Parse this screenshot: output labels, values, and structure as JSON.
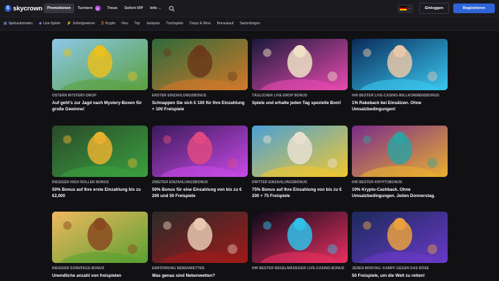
{
  "brand": {
    "name": "skycrown",
    "logo_glyph": "S"
  },
  "nav": [
    {
      "label": "Promotionen",
      "active": true
    },
    {
      "label": "Turniere",
      "badge": "5"
    },
    {
      "label": "Treue"
    },
    {
      "label": "Sofort-VIP"
    },
    {
      "label": "Info",
      "dropdown": true
    }
  ],
  "header": {
    "login_label": "Einloggen",
    "register_label": "Registrieren",
    "language_flag": "de"
  },
  "categories": [
    {
      "icon": "slot-icon",
      "glyph": "▦",
      "label": "Spielautomaten"
    },
    {
      "icon": "live-icon",
      "glyph": "◆",
      "label": "Live-Spiele"
    },
    {
      "icon": "lightning-icon",
      "glyph": "⚡",
      "label": "Sofortgewinne"
    },
    {
      "icon": "crypto-icon",
      "glyph": "₿",
      "label": "Krypto"
    },
    {
      "label": "Neu"
    },
    {
      "label": "Top"
    },
    {
      "label": "Jackpots"
    },
    {
      "label": "Tischspiele"
    },
    {
      "label": "Drops & Wins"
    },
    {
      "label": "Bonuskauf"
    },
    {
      "label": "Sammlungen"
    }
  ],
  "promos": [
    {
      "category": "OSTERN MYSTERY-DROP",
      "title": "Auf geht's zur Jagd nach Mystery-Boxen für große Gewinne!",
      "colors": [
        "#8cc8e8",
        "#5aa040",
        "#e8c020"
      ]
    },
    {
      "category": "ERSTER EINZAHLUNGSBONUS",
      "title": "Schnappen Sie sich € 100 für Ihre Einzahlung + 100 Freispiele",
      "colors": [
        "#2d6a3a",
        "#d2782a",
        "#6a3a1a"
      ]
    },
    {
      "category": "TÄGLICHER LIVE-DROP BONUS",
      "title": "Spiele und erhalte jeden Tag spezielle Boni!",
      "colors": [
        "#1a1a3a",
        "#e84ab0",
        "#f0e0c8"
      ]
    },
    {
      "category": "IHR BESTER LIVE-CASINO-WILLKOMMENSBONUS",
      "title": "1% Rakeback bei Einsätzen. Ohne Umsatzbedingungen!",
      "colors": [
        "#0a2a5a",
        "#3ac8f0",
        "#e8c8a8"
      ]
    },
    {
      "category": "RIESIGER HIGH ROLLER BONUS",
      "title": "50% Bonus auf Ihre erste Einzahlung bis zu €2,000",
      "colors": [
        "#2a4a2a",
        "#3aa040",
        "#e8b030"
      ]
    },
    {
      "category": "ZWEITER EINZAHLUNGSBONUS",
      "title": "50% Bonus für eine Einzahlung von bis zu € 200 und 50 Freispiele",
      "colors": [
        "#3a1a5a",
        "#c84ae8",
        "#e04a80"
      ]
    },
    {
      "category": "DRITTER EINZAHLUNGSBONUS",
      "title": "75% Bonus auf Ihre Einzahlung von bis zu € 200 + 75 Freispiele",
      "colors": [
        "#4aa0d8",
        "#f0c830",
        "#e8e0d0"
      ]
    },
    {
      "category": "IHR BESTER KRYPTOBONUS",
      "title": "10% Krypto-Cashback. Ohne Umsatzbedingungen. Jeden Donnerstag.",
      "colors": [
        "#7a2a8a",
        "#e8b030",
        "#30a0a0"
      ]
    },
    {
      "category": "RIESIGER SONNTAGS-BONUS",
      "title": "Unendliche anzahl von freispielen",
      "colors": [
        "#f0b860",
        "#5aa030",
        "#8a4a20"
      ]
    },
    {
      "category": "EINFÜHRUNG NEBENWETTEN",
      "title": "Was genau sind Nebenwetten?",
      "colors": [
        "#2a2a2a",
        "#a01a1a",
        "#e8c8b0"
      ]
    },
    {
      "category": "IHR BESTER REGELMÄSSIGER LIVE-CASINO-BONUS",
      "title": "",
      "colors": [
        "#0a0a1a",
        "#e83060",
        "#30c0e8"
      ]
    },
    {
      "category": "JEDEN MONTAG: KAMPF GEGEN DAS BÖSE",
      "title": "50 Freispiele, um die Welt zu retten!",
      "colors": [
        "#1a2a5a",
        "#6a3ac8",
        "#e8a040"
      ]
    }
  ]
}
